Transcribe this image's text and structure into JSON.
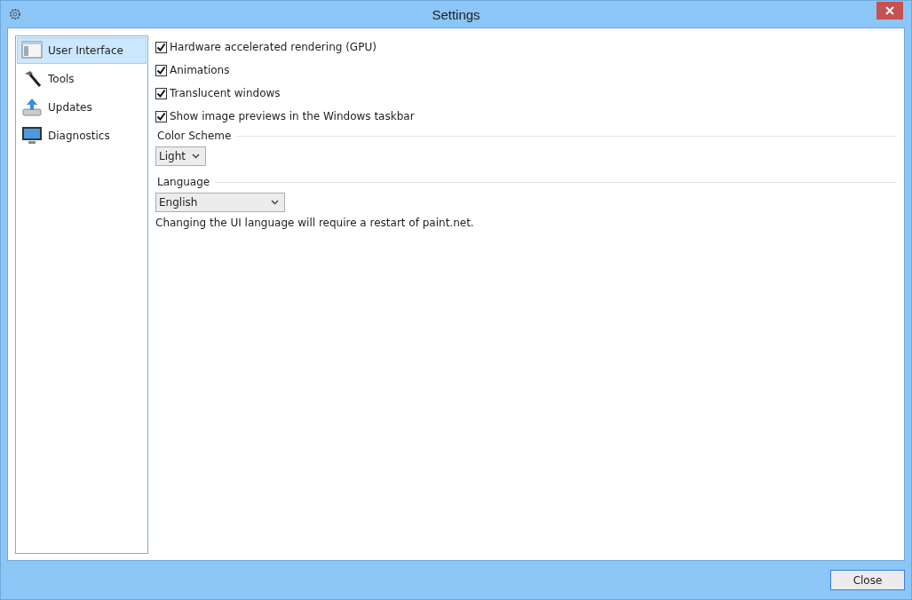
{
  "window": {
    "title": "Settings"
  },
  "sidebar": {
    "items": [
      {
        "label": "User Interface",
        "selected": true
      },
      {
        "label": "Tools",
        "selected": false
      },
      {
        "label": "Updates",
        "selected": false
      },
      {
        "label": "Diagnostics",
        "selected": false
      }
    ]
  },
  "options": [
    {
      "label": "Hardware accelerated rendering (GPU)",
      "checked": true
    },
    {
      "label": "Animations",
      "checked": true
    },
    {
      "label": "Translucent windows",
      "checked": true
    },
    {
      "label": "Show image previews in the Windows taskbar",
      "checked": true
    }
  ],
  "color_scheme": {
    "heading": "Color Scheme",
    "value": "Light"
  },
  "language": {
    "heading": "Language",
    "value": "English",
    "note": "Changing the UI language will require a restart of paint.net."
  },
  "buttons": [
    "Close"
  ]
}
